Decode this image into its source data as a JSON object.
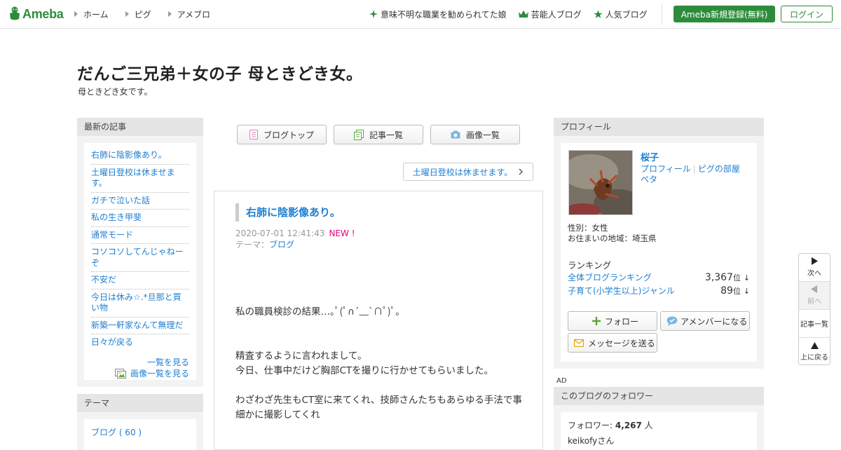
{
  "header": {
    "logo_text": "Ameba",
    "nav": [
      "ホーム",
      "ピグ",
      "アメブロ"
    ],
    "featured": "意味不明な職業を勧められてた娘",
    "celeb_blog": "芸能人ブログ",
    "popular_blog": "人気ブログ",
    "register": "Ameba新規登録(無料)",
    "login": "ログイン",
    "colors": {
      "brand": "#2d8c3c",
      "link": "#1e7ed2",
      "new": "#e4007f"
    }
  },
  "blog": {
    "title": "だんご三兄弟＋女の子 母ときどき女。",
    "description": "母ときどき女です。"
  },
  "left_sidebar": {
    "latest_head": "最新の記事",
    "latest_articles": [
      "右肺に陰影像あり。",
      "土曜日登校は休ませます。",
      "ガチで泣いた話",
      "私の生き甲斐",
      "通常モード",
      "コソコソしてんじゃねーぞ",
      "不安だ",
      "今日は休み☆.*旦那と買い物",
      "新築一軒家なんて無理だ",
      "日々が戻る"
    ],
    "see_all": "一覧を見る",
    "see_images": "画像一覧を見る",
    "theme_head": "テーマ",
    "theme_item": "ブログ ( 60 )"
  },
  "center": {
    "tabs": [
      "ブログトップ",
      "記事一覧",
      "画像一覧"
    ],
    "next_post": "土曜日登校は休ませます。",
    "article": {
      "title": "右肺に陰影像あり。",
      "date": "2020-07-01 12:41:43",
      "new_badge": "NEW !",
      "theme_label": "テーマ：",
      "theme": "ブログ",
      "body": [
        "私の職員検診の結果…｡ﾟ(ﾟ∩´﹏`∩ﾟ)ﾟ｡",
        "",
        "精査するように言われまして。",
        "今日、仕事中だけど胸部CTを撮りに行かせてもらいました。",
        "",
        "わざわざ先生もCT室に来てくれ、技師さんたちもあらゆる手法で事細かに撮影してくれ"
      ]
    }
  },
  "right_sidebar": {
    "profile_head": "プロフィール",
    "name": "桜子",
    "link_profile": "プロフィール",
    "link_pig_room": "ピグの部屋",
    "link_peta": "ペタ",
    "gender": "性別：女性",
    "location": "お住まいの地域：埼玉県",
    "ranking_label": "ランキング",
    "ranking": [
      {
        "name": "全体ブログランキング",
        "value": "3,367",
        "unit": "位",
        "trend": "↓"
      },
      {
        "name": "子育て(小学生以上)ジャンル",
        "value": "89",
        "unit": "位",
        "trend": "↓"
      }
    ],
    "follow_btn": "フォロー",
    "amember_btn": "アメンバーになる",
    "message_btn": "メッセージを送る",
    "ad_label": "AD",
    "followers_head": "このブログのフォロワー",
    "followers_label": "フォロワー:",
    "followers_count": "4,267",
    "followers_unit": "人",
    "follower_user": "keikofyさん"
  },
  "pager": {
    "next": "次へ",
    "prev": "前へ",
    "list": "記事一覧",
    "top": "上に戻る"
  }
}
